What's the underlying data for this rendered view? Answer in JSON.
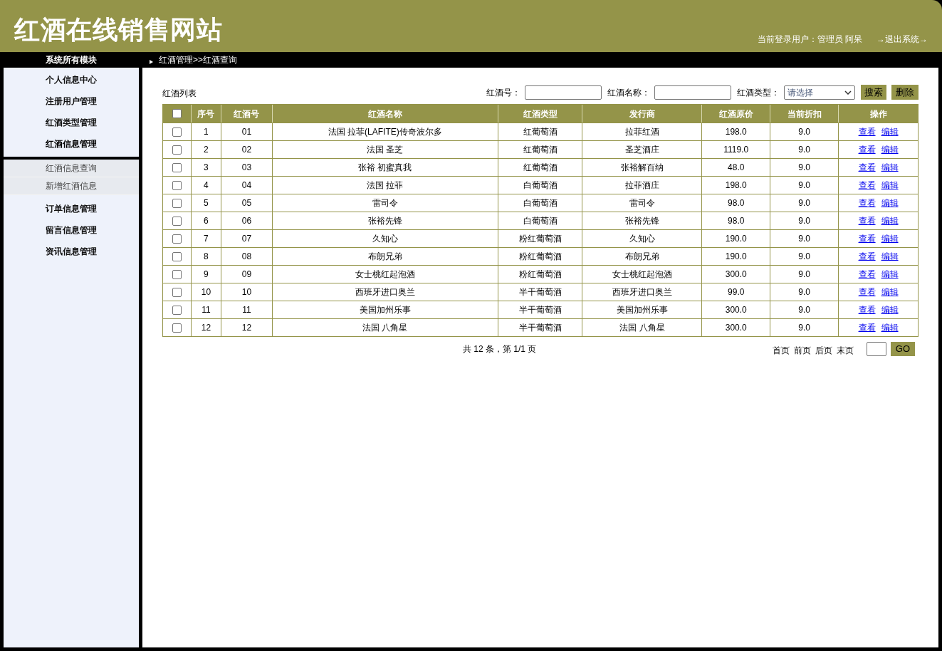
{
  "header": {
    "title": "红酒在线销售网站",
    "user_info": "当前登录用户：管理员 阿呆",
    "logout_link": "→退出系统→"
  },
  "sidebar": {
    "title": "系统所有模块",
    "items": [
      {
        "label": "个人信息中心",
        "expanded": false
      },
      {
        "label": "注册用户管理",
        "expanded": false
      },
      {
        "label": "红酒类型管理",
        "expanded": false
      },
      {
        "label": "红酒信息管理",
        "expanded": true,
        "children": [
          {
            "label": "红酒信息查询"
          },
          {
            "label": "新增红酒信息"
          }
        ]
      },
      {
        "label": "订单信息管理",
        "expanded": false
      },
      {
        "label": "留言信息管理",
        "expanded": false
      },
      {
        "label": "资讯信息管理",
        "expanded": false
      }
    ]
  },
  "breadcrumb": "红酒管理>>红酒查询",
  "list_title": "红酒列表",
  "filters": {
    "wine_no_label": "红酒号：",
    "wine_name_label": "红酒名称：",
    "wine_type_label": "红酒类型：",
    "wine_type_placeholder": "请选择",
    "search_button": "搜索",
    "delete_button": "删除"
  },
  "table": {
    "select_all_checked": false,
    "columns": [
      "序号",
      "红酒号",
      "红酒名称",
      "红酒类型",
      "发行商",
      "红酒原价",
      "当前折扣",
      "操作"
    ],
    "rows": [
      {
        "checked": false,
        "cells": [
          "1",
          "01",
          "法国 拉菲(LAFITE)传奇波尔多",
          "红葡萄酒",
          "拉菲红酒",
          "198.0",
          "9.0"
        ],
        "actions": [
          "查看",
          "编辑"
        ]
      },
      {
        "checked": false,
        "cells": [
          "2",
          "02",
          "法国 圣芝",
          "红葡萄酒",
          "圣芝酒庄",
          "1119.0",
          "9.0"
        ],
        "actions": [
          "查看",
          "编辑"
        ]
      },
      {
        "checked": false,
        "cells": [
          "3",
          "03",
          "张裕 初蜜真我",
          "红葡萄酒",
          "张裕解百纳",
          "48.0",
          "9.0"
        ],
        "actions": [
          "查看",
          "编辑"
        ]
      },
      {
        "checked": false,
        "cells": [
          "4",
          "04",
          "法国 拉菲",
          "白葡萄酒",
          "拉菲酒庄",
          "198.0",
          "9.0"
        ],
        "actions": [
          "查看",
          "编辑"
        ]
      },
      {
        "checked": false,
        "cells": [
          "5",
          "05",
          "雷司令",
          "白葡萄酒",
          "雷司令",
          "98.0",
          "9.0"
        ],
        "actions": [
          "查看",
          "编辑"
        ]
      },
      {
        "checked": false,
        "cells": [
          "6",
          "06",
          "张裕先锋",
          "白葡萄酒",
          "张裕先锋",
          "98.0",
          "9.0"
        ],
        "actions": [
          "查看",
          "编辑"
        ]
      },
      {
        "checked": false,
        "cells": [
          "7",
          "07",
          "久知心",
          "粉红葡萄酒",
          "久知心",
          "190.0",
          "9.0"
        ],
        "actions": [
          "查看",
          "编辑"
        ]
      },
      {
        "checked": false,
        "cells": [
          "8",
          "08",
          "布朗兄弟",
          "粉红葡萄酒",
          "布朗兄弟",
          "190.0",
          "9.0"
        ],
        "actions": [
          "查看",
          "编辑"
        ]
      },
      {
        "checked": false,
        "cells": [
          "9",
          "09",
          "女士桃红起泡酒",
          "粉红葡萄酒",
          "女士桃红起泡酒",
          "300.0",
          "9.0"
        ],
        "actions": [
          "查看",
          "编辑"
        ]
      },
      {
        "checked": false,
        "cells": [
          "10",
          "10",
          "西班牙进口奥兰",
          "半干葡萄酒",
          "西班牙进口奥兰",
          "99.0",
          "9.0"
        ],
        "actions": [
          "查看",
          "编辑"
        ]
      },
      {
        "checked": false,
        "cells": [
          "11",
          "11",
          "美国加州乐事",
          "半干葡萄酒",
          "美国加州乐事",
          "300.0",
          "9.0"
        ],
        "actions": [
          "查看",
          "编辑"
        ]
      },
      {
        "checked": false,
        "cells": [
          "12",
          "12",
          "法国 八角星",
          "半干葡萄酒",
          "法国 八角星",
          "300.0",
          "9.0"
        ],
        "actions": [
          "查看",
          "编辑"
        ]
      }
    ]
  },
  "pagination": {
    "summary": "共 12 条，第 1/1 页",
    "links": [
      "首页",
      "前页",
      "后页",
      "末页"
    ],
    "go_button": "GO"
  }
}
